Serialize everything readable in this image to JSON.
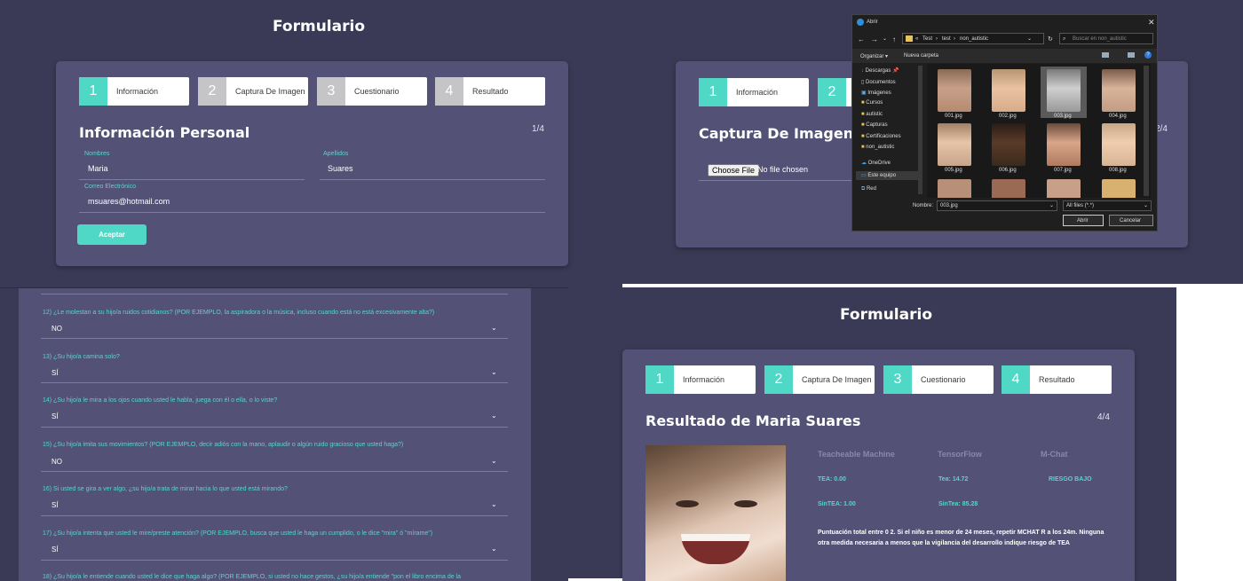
{
  "top_left": {
    "title": "Formulario",
    "steps": [
      {
        "num": "1",
        "label": "Información"
      },
      {
        "num": "2",
        "label": "Captura De Imagen"
      },
      {
        "num": "3",
        "label": "Cuestionario"
      },
      {
        "num": "4",
        "label": "Resultado"
      }
    ],
    "heading": "Información Personal",
    "pager": "1/4",
    "fields": {
      "nombres_label": "Nombres",
      "nombres_value": "Maria",
      "apellidos_label": "Apellidos",
      "apellidos_value": "Suares",
      "correo_label": "Correo Electrónico",
      "correo_value": "msuares@hotmail.com"
    },
    "accept_label": "Aceptar"
  },
  "top_right": {
    "steps": [
      {
        "num": "1",
        "label": "Información"
      },
      {
        "num": "2",
        "label": ""
      }
    ],
    "heading": "Captura De Imagen",
    "pager": "2/4",
    "choose_file": "Choose File",
    "no_file": "No file chosen"
  },
  "dialog": {
    "title": "Abrir",
    "breadcrumb": [
      "«",
      "Test",
      "test",
      "non_autistic"
    ],
    "search_placeholder": "Buscar en non_autistic",
    "organize": "Organizar ▾",
    "new_folder": "Nueva carpeta",
    "tree": [
      "Descargas",
      "Documentos",
      "Imágenes",
      "Cursos",
      "autistic",
      "Capturas",
      "Certificaciones",
      "non_autistic",
      "OneDrive",
      "Este equipo",
      "Red"
    ],
    "files": [
      "001.jpg",
      "002.jpg",
      "003.jpg",
      "004.jpg",
      "005.jpg",
      "006.jpg",
      "007.jpg",
      "008.jpg"
    ],
    "name_label": "Nombre:",
    "name_value": "003.jpg",
    "filter": "All files (*.*)",
    "open": "Abrir",
    "cancel": "Cancelar"
  },
  "questions": [
    {
      "q": "12) ¿Le molestan a su hijo/a ruidos cotidianos? (POR EJEMPLO, la aspiradora o la música, incluso cuando está no está excesivamente alta?)",
      "a": "NO"
    },
    {
      "q": "13) ¿Su hijo/a camina solo?",
      "a": "SÍ"
    },
    {
      "q": "14) ¿Su hijo/a le mira a los ojos cuando usted le habla, juega con él o ella, o lo viste?",
      "a": "SÍ"
    },
    {
      "q": "15) ¿Su hijo/a imita sus movimientos? (POR EJEMPLO, decir adiós con la mano, aplaudir o algún ruido gracioso que usted haga?)",
      "a": "NO"
    },
    {
      "q": "16) Si usted se gira a ver algo, ¿su hijo/a trata de mirar hacia lo que usted está mirando?",
      "a": "SÍ"
    },
    {
      "q": "17) ¿Su hijo/a intenta que usted le mire/preste atención? (POR EJEMPLO, busca que usted le haga un cumplido, o le dice \"mira\" ó \"mírame\")",
      "a": "SÍ"
    },
    {
      "q": "18) ¿Su hijo/a le entiende cuando usted le dice que haga algo? (POR EJEMPLO, si usted no hace gestos, ¿su hijo/a entiende \"pon el libro encima de la",
      "a": ""
    }
  ],
  "result": {
    "title": "Formulario",
    "steps": [
      {
        "num": "1",
        "label": "Información"
      },
      {
        "num": "2",
        "label": "Captura De Imagen"
      },
      {
        "num": "3",
        "label": "Cuestionario"
      },
      {
        "num": "4",
        "label": "Resultado"
      }
    ],
    "heading": "Resultado de Maria Suares",
    "pager": "4/4",
    "cols": [
      "Teacheable Machine",
      "TensorFlow",
      "M-Chat"
    ],
    "tea": [
      "TEA: 0.00",
      "Tea: 14.72",
      "RIESGO BAJO"
    ],
    "sintea": [
      "SinTEA: 1.00",
      "SinTea: 85.28"
    ],
    "summary": "Puntuación total entre 0 2. Si el niño es menor de 24 meses, repetir MCHAT R a los 24m. Ninguna otra medida necesaria a menos que la vigilancia del desarrollo indique riesgo de TEA"
  },
  "colors": {
    "accent": "#4fd8c6",
    "panel": "#535276",
    "background": "#3b3a56"
  }
}
